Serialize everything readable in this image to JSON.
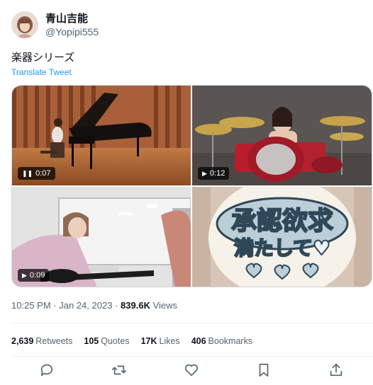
{
  "user": {
    "display_name": "青山吉能",
    "handle": "@Yopipi555"
  },
  "tweet": {
    "text": "楽器シリーズ",
    "translate_label": "Translate Tweet"
  },
  "media": [
    {
      "badge_glyph": "❚❚",
      "duration": "0:07",
      "description": "piano"
    },
    {
      "badge_glyph": "▶",
      "duration": "0:12",
      "description": "drums"
    },
    {
      "badge_glyph": "▶",
      "duration": "0:09",
      "description": "guitar"
    },
    {
      "sign_line1": "承認欲求",
      "sign_line2": "満たして♥"
    }
  ],
  "meta": {
    "time": "10:25 PM",
    "separator1": "·",
    "date": "Jan 24, 2023",
    "separator2": "·",
    "views_count": "839.6K",
    "views_label": "Views"
  },
  "stats": {
    "retweets_count": "2,639",
    "retweets_label": "Retweets",
    "quotes_count": "105",
    "quotes_label": "Quotes",
    "likes_count": "17K",
    "likes_label": "Likes",
    "bookmarks_count": "406",
    "bookmarks_label": "Bookmarks"
  },
  "actions": [
    "reply-icon",
    "retweet-icon",
    "like-icon",
    "bookmark-icon",
    "share-icon"
  ],
  "colors": {
    "text_primary": "#0f1419",
    "text_secondary": "#536471",
    "link": "#1d9bf0",
    "divider": "#eff3f4"
  }
}
